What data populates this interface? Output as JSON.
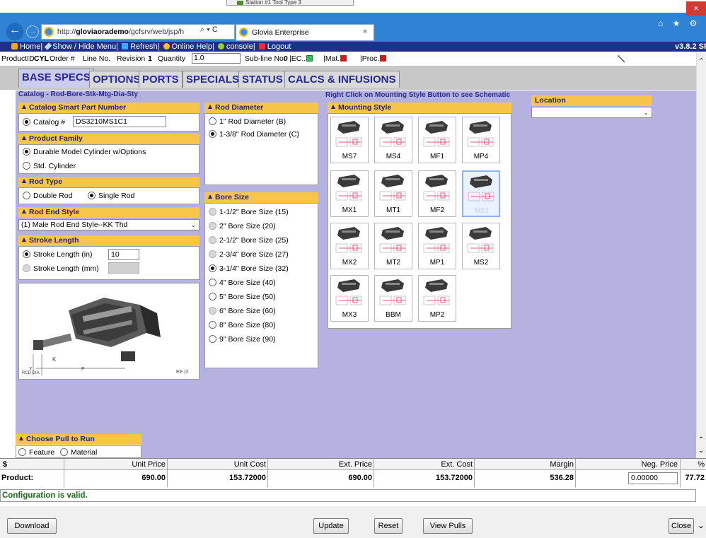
{
  "browser": {
    "url_prefix": "http://",
    "url_domain": "gloviaorademo",
    "url_rest": "/gcfsrv/web/jsp/h",
    "url_tools": "⌕ ▾ C",
    "tab_title": "Glovia Enterprise",
    "tab_close": "×",
    "back": "←",
    "forward": "→",
    "background_tab": "Station #1 Tool Type 3",
    "window_controls": {
      "minimize": "–",
      "maximize": "□",
      "close": "×"
    },
    "toolbar_icons": "⌂ ★ ⚙"
  },
  "menubar": {
    "items": [
      {
        "label": "Home",
        "sep": " | "
      },
      {
        "label": "Show / Hide Menu",
        "sep": " | "
      },
      {
        "label": "Refresh",
        "sep": " | "
      },
      {
        "label": "Online Help",
        "sep": " | "
      },
      {
        "label": "console",
        "sep": " | "
      },
      {
        "label": "Logout",
        "sep": ""
      }
    ],
    "version": "v3.8.2 SP"
  },
  "infobar": {
    "product_id_label": "ProductID",
    "product_id": "CYL",
    "order_label": "Order #",
    "line_label": "Line No.",
    "revision_label": "Revision",
    "revision": "1",
    "quantity_label": "Quantity",
    "quantity": "1.0",
    "subline_label": "Sub-line No.",
    "subline": "0",
    "ec_label": "|EC..",
    "mat_label": "|Mat.",
    "proc_label": "|Proc."
  },
  "tabs": [
    {
      "label": "BASE SPECS"
    },
    {
      "label": "OPTIONS"
    },
    {
      "label": "PORTS"
    },
    {
      "label": "SPECIALS"
    },
    {
      "label": "STATUS"
    },
    {
      "label": "CALCS & INFUSIONS"
    }
  ],
  "catalog_title": "Catalog - Rod-Bore-Stk-Mtg-Dia-Sty",
  "catalog": {
    "header": "Catalog Smart Part Number",
    "option_label": "Catalog #",
    "value": "DS3210MS1C1"
  },
  "product_family": {
    "header": "Product Family",
    "options": [
      "Durable Model Cylinder w/Options",
      "Std. Cylinder"
    ]
  },
  "rod_type": {
    "header": "Rod Type",
    "options": [
      "Double Rod",
      "Single Rod"
    ]
  },
  "rod_end_style": {
    "header": "Rod End Style",
    "value": "(1) Male Rod End Style--KK Thd"
  },
  "stroke_length": {
    "header": "Stroke Length",
    "inches_label": "Stroke Length (in)",
    "inches_value": "10",
    "mm_label": "Stroke Length (mm)"
  },
  "diagram_labels": {
    "k": "K",
    "y": "Y",
    "p": "P",
    "rod_dia": "RCD\nDIA",
    "ee": "EE (2"
  },
  "rod_diameter": {
    "header": "Rod Diameter",
    "options": [
      "1\" Rod Diameter (B)",
      "1-3/8\" Rod Diameter (C)"
    ]
  },
  "bore_size": {
    "header": "Bore Size",
    "options": [
      "1-1/2\" Bore Size (15)",
      "2\" Bore Size  (20)",
      "2-1/2\" Bore Size  (25)",
      "2-3/4\" Bore Size  (27)",
      "3-1/4\" Bore Size  (32)",
      "4\" Bore Size  (40)",
      "5\" Bore Size  (50)",
      "6\" Bore Size  (60)",
      "8\" Bore Size  (80)",
      "9\" Bore Size  (90)"
    ]
  },
  "mounting": {
    "hint": "Right Click on Mounting Style Button to see Schematic",
    "header": "Mounting Style",
    "styles": [
      "MS7",
      "MS4",
      "MF1",
      "MP4",
      "MX1",
      "MT1",
      "MF2",
      "MS1",
      "MX2",
      "MT2",
      "MP1",
      "MS2",
      "MX3",
      "BBM",
      "MP2"
    ]
  },
  "location": {
    "header": "Location",
    "value": ""
  },
  "pull_to_run": {
    "header": "Choose Pull to Run",
    "options": [
      "Feature",
      "Material"
    ]
  },
  "pricing": {
    "currency": "$",
    "headers": [
      "Unit Price",
      "Unit Cost",
      "Ext. Price",
      "Ext. Cost",
      "Margin",
      "Neg. Price",
      "%"
    ],
    "row_label": "Product:",
    "values": [
      "690.00",
      "153.72000",
      "690.00",
      "153.72000",
      "536.28",
      "0.00000",
      "77.72"
    ]
  },
  "status_message": "Configuration is valid.",
  "buttons": {
    "download": "Download",
    "update": "Update",
    "reset": "Reset",
    "view_pulls": "View Pulls",
    "close": "Close"
  },
  "colors": {
    "accent_blue": "#1f2f8a",
    "section_header": "#f6c54a",
    "panel": "#b6b2e0",
    "valid": "#1c6b1c"
  }
}
